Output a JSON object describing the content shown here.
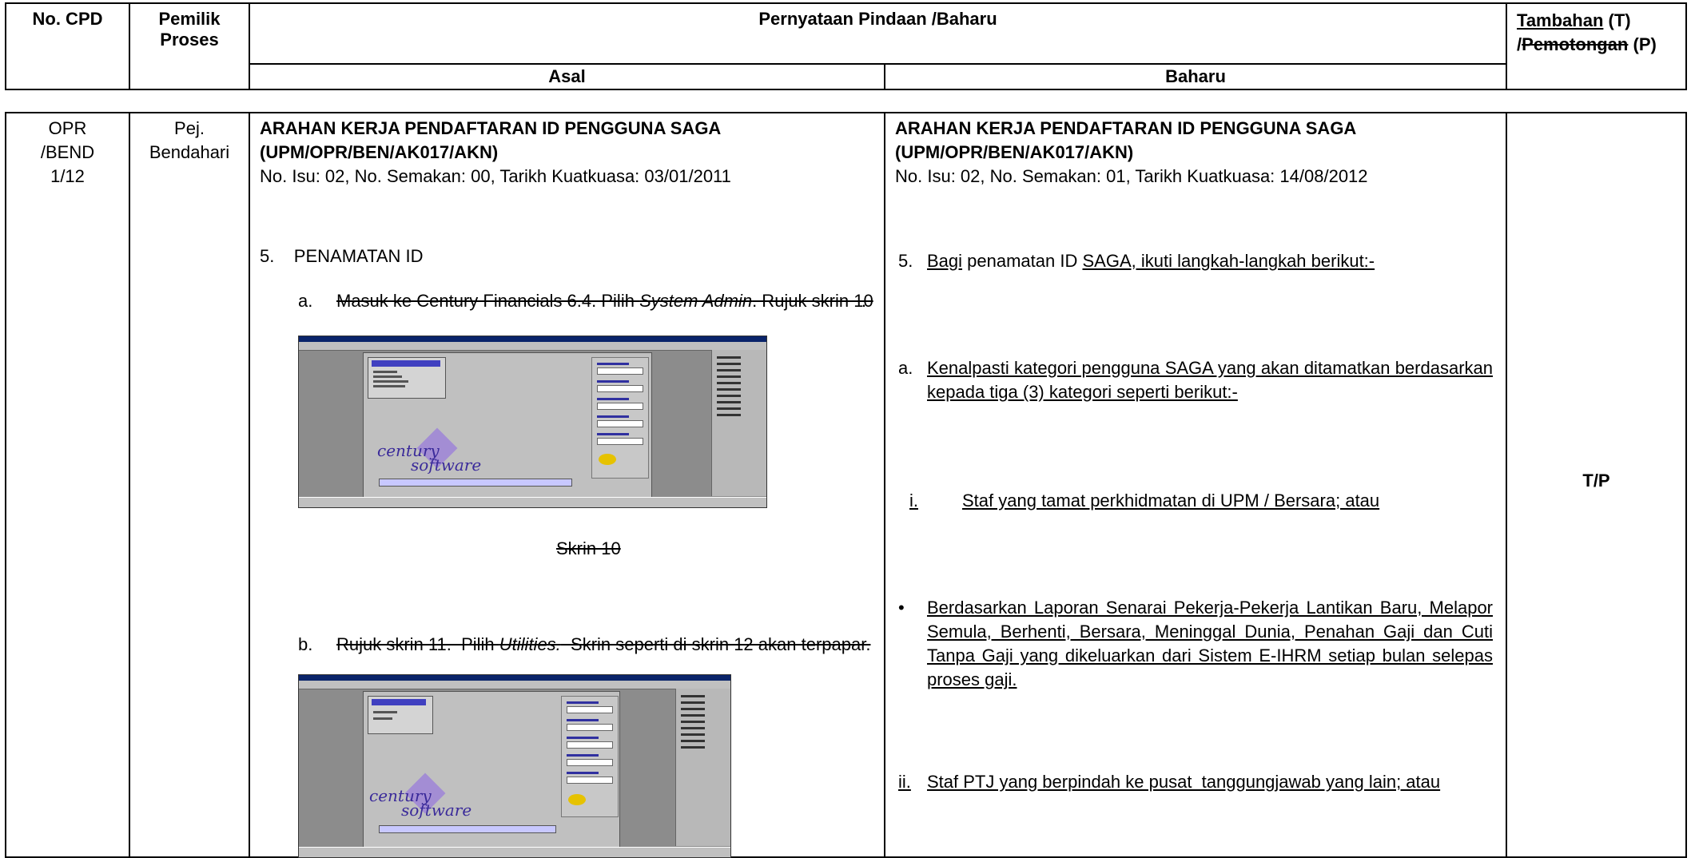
{
  "header": {
    "col_no_cpd": "No. CPD",
    "col_pemilik": "Pemilik\nProses",
    "col_pernyataan": "Pernyataan Pindaan /Baharu",
    "col_tambahan_1": "Tambahan",
    "col_tambahan_2": " (T)",
    "col_tambahan_3": "/",
    "col_tambahan_4": "Pemotongan",
    "col_tambahan_5": " (P)",
    "sub_asal": "Asal",
    "sub_baharu": "Baharu"
  },
  "row": {
    "no_cpd_1": "OPR",
    "no_cpd_2": "/BEND",
    "no_cpd_3": "1/12",
    "pemilik_1": "Pej.",
    "pemilik_2": "Bendahari",
    "status": "T/P",
    "asal": {
      "title_1": "ARAHAN KERJA PENDAFTARAN ID PENGGUNA SAGA",
      "title_2": "(UPM/OPR/BEN/AK017/AKN)",
      "isu": "No. Isu: 02, No. Semakan: 00, Tarikh Kuatkuasa: 03/01/2011",
      "s5": "5.    PENAMATAN ID",
      "a_num": "a.",
      "a_text_1": "Masuk ke Century Financials 6.4. Pilih ",
      "a_text_em": "System Admin",
      "a_text_2": ". Rujuk skrin 10",
      "a_text_3": ".",
      "caption_10": "Skrin 10",
      "b_num": "b.",
      "b_text_1": "Rujuk skrin 11.  Pilih ",
      "b_text_em": "Utilities.",
      "b_text_2": "  Skrin seperti di skrin 12 akan terpapar."
    },
    "baharu": {
      "title_1": "ARAHAN KERJA PENDAFTARAN ID PENGGUNA SAGA",
      "title_2": "(UPM/OPR/BEN/AK017/AKN)",
      "isu": "No. Isu: 02, No. Semakan: 01, Tarikh Kuatkuasa: 14/08/2012",
      "s5_num": "5.",
      "s5_u1": "Bagi",
      "s5_mid": " penamatan ID ",
      "s5_u2": "SAGA, ikuti langkah-langkah berikut:-",
      "a_num": "a.",
      "a_text": "Kenalpasti kategori pengguna SAGA yang akan ditamatkan berdasarkan kepada tiga (3) kategori seperti berikut:-",
      "i_num": "i.",
      "i_text": "Staf yang tamat perkhidmatan di UPM / Bersara; atau",
      "bullet": "•",
      "bullet_text": "Berdasarkan Laporan Senarai Pekerja-Pekerja Lantikan Baru, Melapor Semula, Berhenti, Bersara, Meninggal Dunia, Penahan Gaji dan Cuti Tanpa Gaji yang dikeluarkan dari Sistem E-IHRM setiap bulan selepas proses gaji.",
      "ii_num": "ii.",
      "ii_text": "Staf PTJ yang berpindah ke pusat  tanggungjawab yang lain; atau"
    }
  },
  "screenshots": {
    "logo_word_1": "century",
    "logo_word_2": "software"
  }
}
